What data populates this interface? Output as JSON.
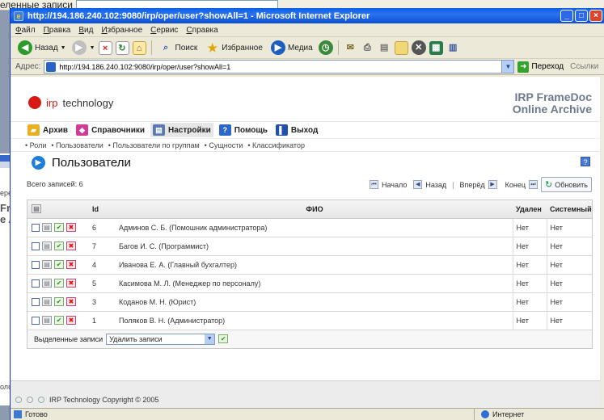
{
  "background": {
    "top_label": "еленные записи",
    "left_snippets": [
      "ерех",
      "Fra",
      "e A"
    ],
    "left_bottom": "олог"
  },
  "window": {
    "title": "http://194.186.240.102:9080/irp/oper/user?showAll=1 - Microsoft Internet Explorer",
    "minimize": "_",
    "maximize": "□",
    "close": "×"
  },
  "menubar": [
    "Файл",
    "Правка",
    "Вид",
    "Избранное",
    "Сервис",
    "Справка"
  ],
  "toolbar": {
    "back": "Назад",
    "search": "Поиск",
    "favorites": "Избранное",
    "media": "Медиа"
  },
  "address": {
    "label": "Адрес:",
    "url": "http://194.186.240.102:9080/irp/oper/user?showAll=1",
    "go": "Переход",
    "links": "Ссылки"
  },
  "page": {
    "logo_irp": "irp",
    "logo_tech": "technology",
    "brand_line1": "IRP FrameDoc",
    "brand_line2": "Online Archive",
    "nav": [
      "Архив",
      "Справочники",
      "Настройки",
      "Помощь",
      "Выход"
    ],
    "subnav": [
      "Роли",
      "Пользователи",
      "Пользователи по группам",
      "Сущности",
      "Классификатор"
    ],
    "title": "Пользователи",
    "help": "?",
    "total": "Всего записей: 6",
    "pager": {
      "first": "Начало",
      "prev": "Назад",
      "next": "Вперёд",
      "last": "Конец",
      "refresh": "Обновить"
    },
    "columns": {
      "id": "Id",
      "fio": "ФИО",
      "deleted": "Удален",
      "system": "Системный"
    },
    "rows": [
      {
        "id": "6",
        "fio": "Админов С. Б. (Помошник администратора)",
        "deleted": "Нет",
        "system": "Нет"
      },
      {
        "id": "7",
        "fio": "Багов И. С. (Программист)",
        "deleted": "Нет",
        "system": "Нет"
      },
      {
        "id": "4",
        "fio": "Иванова Е. А. (Главный бухгалтер)",
        "deleted": "Нет",
        "system": "Нет"
      },
      {
        "id": "5",
        "fio": "Касимова М. Л. (Менеджер по персоналу)",
        "deleted": "Нет",
        "system": "Нет"
      },
      {
        "id": "3",
        "fio": "Коданов М. Н. (Юрист)",
        "deleted": "Нет",
        "system": "Нет"
      },
      {
        "id": "1",
        "fio": "Поляков В. Н. (Администратор)",
        "deleted": "Нет",
        "system": "Нет"
      }
    ],
    "bulk_label": "Выделенные записи",
    "bulk_action": "Удалить записи",
    "footer": "IRP Technology Copyright © 2005"
  },
  "status": {
    "left": "Готово",
    "right": "Интернет"
  },
  "colors": {
    "title_bar": "#0a5fe8",
    "logo_red": "#d81a14",
    "brand": "#6d7a8a"
  }
}
